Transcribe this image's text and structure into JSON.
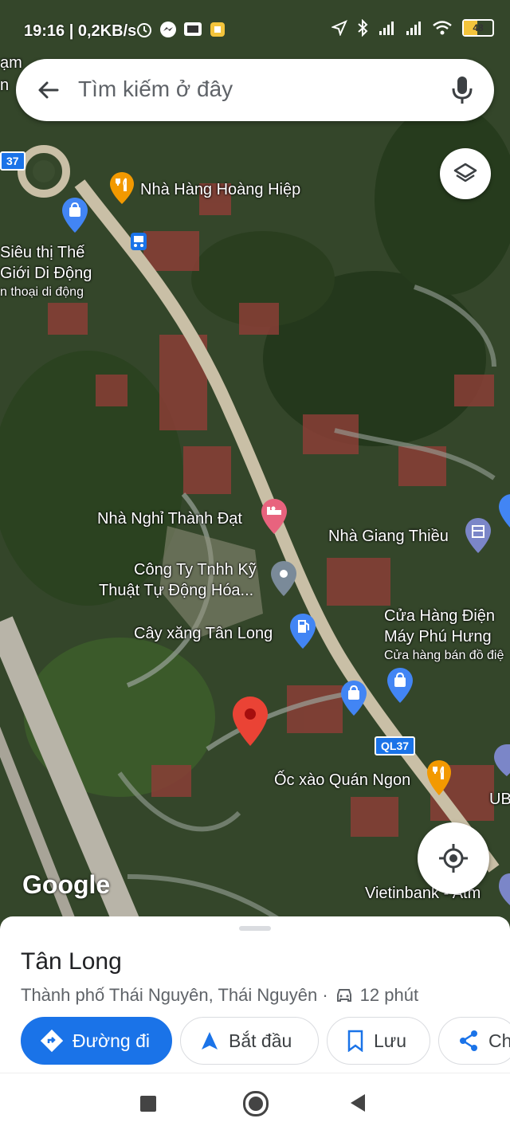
{
  "status_bar": {
    "time": "19:16",
    "speed": "0,2KB/s",
    "battery": "48",
    "battery_level": 0.48,
    "icons": [
      "alarm-icon",
      "messenger-icon",
      "tv-app-icon",
      "clipboard-app-icon",
      "location-arrow-icon",
      "bluetooth-icon",
      "signal-icon",
      "signal-icon",
      "wifi-icon"
    ]
  },
  "search": {
    "placeholder": "Tìm kiếm ở đây"
  },
  "map": {
    "labels": {
      "restaurant_hoang_hiep": "Nhà Hàng Hoàng Hiệp",
      "sieu_thi_line1": "Siêu thị Thế",
      "sieu_thi_line2": "Giới Di Động",
      "sieu_thi_sub": "n thoại di động",
      "top_left_cut1": "ạm",
      "top_left_cut2": "n",
      "nha_nghi": "Nhà Nghỉ Thành Đạt",
      "nha_giang": "Nhà Giang Thiều",
      "cong_ty_line1": "Công Ty Tnhh Kỹ",
      "cong_ty_line2": "Thuật Tự Động Hóa...",
      "cay_xang": "Cây xăng Tân Long",
      "cua_hang_line1": "Cửa Hàng Điện",
      "cua_hang_line2": "Máy Phú Hưng",
      "cua_hang_sub": "Cửa hàng bán đồ điệ",
      "oc_xao": "Ốc xào Quán Ngon",
      "ub_cut": "UB",
      "vietinbank": "Vietinbank - Atm",
      "google": "Google"
    },
    "road_shields": [
      "37",
      "QL37"
    ]
  },
  "place": {
    "name": "Tân Long",
    "address": "Thành phố Thái Nguyên, Thái Nguyên ·",
    "drive_time": "12 phút"
  },
  "actions": {
    "directions": "Đường đi",
    "start": "Bắt đầu",
    "save": "Lưu",
    "share": "Ch"
  },
  "colors": {
    "accent": "#1a73e8",
    "pin_red": "#ea4335"
  }
}
